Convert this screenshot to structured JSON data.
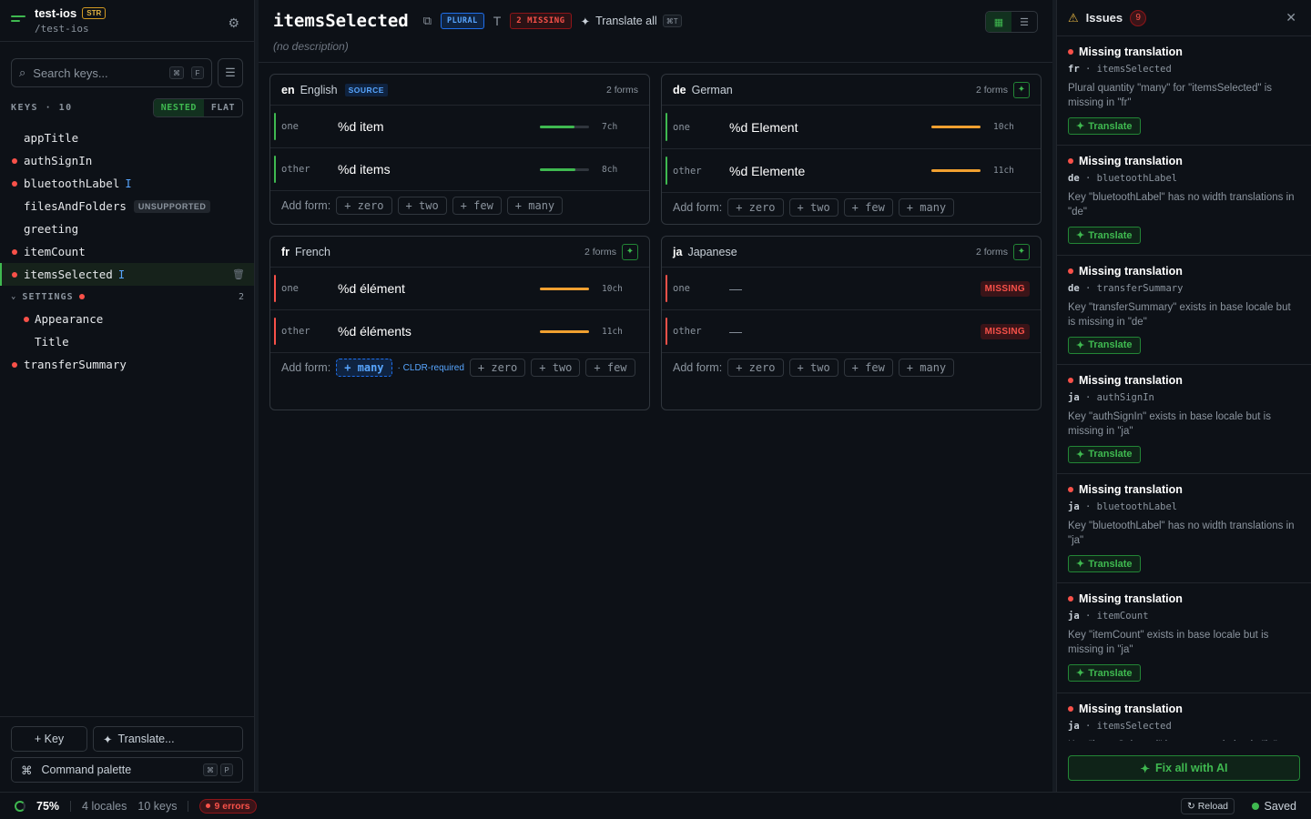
{
  "project": {
    "name": "test-ios",
    "badge": "STR",
    "path": "/test-ios"
  },
  "sidebar": {
    "search_placeholder": "Search keys...",
    "search_kbd": [
      "⌘",
      "F"
    ],
    "keys_title": "KEYS · 10",
    "view_nested": "NESTED",
    "view_flat": "FLAT",
    "keys": [
      {
        "label": "appTitle",
        "missing": false
      },
      {
        "label": "authSignIn",
        "missing": true
      },
      {
        "label": "bluetoothLabel",
        "missing": true,
        "icon": "width-icon"
      },
      {
        "label": "filesAndFolders",
        "missing": false,
        "tag": "UNSUPPORTED"
      },
      {
        "label": "greeting",
        "missing": false
      },
      {
        "label": "itemCount",
        "missing": true
      },
      {
        "label": "itemsSelected",
        "missing": true,
        "active": true
      }
    ],
    "group": {
      "label": "SETTINGS",
      "count": "2",
      "children": [
        {
          "label": "Appearance",
          "missing": true
        },
        {
          "label": "Title",
          "missing": false
        }
      ]
    },
    "last_key": {
      "label": "transferSummary",
      "missing": true
    },
    "add_key": "+ Key",
    "translate": "Translate...",
    "command_palette": "Command palette",
    "command_kbd": [
      "⌘",
      "P"
    ]
  },
  "header": {
    "title": "itemsSelected",
    "plural_badge": "PLURAL",
    "missing_badge": "2 MISSING",
    "translate_all": "Translate all",
    "translate_all_kbd": "⌘T",
    "description": "(no description)"
  },
  "locales": [
    {
      "code": "en",
      "name": "English",
      "source": "SOURCE",
      "forms_count": "2 forms",
      "forms": [
        {
          "label": "one",
          "value": "%d item",
          "ch": "7ch",
          "fill": 0.7,
          "color": "#3fb950"
        },
        {
          "label": "other",
          "value": "%d items",
          "ch": "8ch",
          "fill": 0.72,
          "color": "#3fb950"
        }
      ],
      "add_label": "Add form:",
      "add": [
        "+ zero",
        "+ two",
        "+ few",
        "+ many"
      ]
    },
    {
      "code": "de",
      "name": "German",
      "forms_count": "2 forms",
      "forms": [
        {
          "label": "one",
          "value": "%d Element",
          "ch": "10ch",
          "fill": 1.0,
          "color": "#f0a030"
        },
        {
          "label": "other",
          "value": "%d Elemente",
          "ch": "11ch",
          "fill": 1.0,
          "color": "#f0a030"
        }
      ],
      "add_label": "Add form:",
      "add": [
        "+ zero",
        "+ two",
        "+ few",
        "+ many"
      ]
    },
    {
      "code": "fr",
      "name": "French",
      "forms_count": "2 forms",
      "forms": [
        {
          "label": "one",
          "value": "%d élément",
          "ch": "10ch",
          "fill": 1.0,
          "color": "#f0a030"
        },
        {
          "label": "other",
          "value": "%d éléments",
          "ch": "11ch",
          "fill": 1.0,
          "color": "#f0a030"
        }
      ],
      "add_label": "Add form:",
      "add_required": "+ many",
      "cldr": "· CLDR-required",
      "add": [
        "+ zero",
        "+ two",
        "+ few"
      ]
    },
    {
      "code": "ja",
      "name": "Japanese",
      "forms_count": "2 forms",
      "forms": [
        {
          "label": "one",
          "value": "—",
          "missing": "MISSING"
        },
        {
          "label": "other",
          "value": "—",
          "missing": "MISSING"
        }
      ],
      "add_label": "Add form:",
      "add": [
        "+ zero",
        "+ two",
        "+ few",
        "+ many"
      ]
    }
  ],
  "issues": {
    "title": "Issues",
    "count": "9",
    "translate_label": "Translate",
    "items": [
      {
        "title": "Missing translation",
        "locale": "fr",
        "key": "itemsSelected",
        "message": "Plural quantity \"many\" for \"itemsSelected\" is missing in \"fr\""
      },
      {
        "title": "Missing translation",
        "locale": "de",
        "key": "bluetoothLabel",
        "message": "Key \"bluetoothLabel\" has no width translations in \"de\""
      },
      {
        "title": "Missing translation",
        "locale": "de",
        "key": "transferSummary",
        "message": "Key \"transferSummary\" exists in base locale but is missing in \"de\""
      },
      {
        "title": "Missing translation",
        "locale": "ja",
        "key": "authSignIn",
        "message": "Key \"authSignIn\" exists in base locale but is missing in \"ja\""
      },
      {
        "title": "Missing translation",
        "locale": "ja",
        "key": "bluetoothLabel",
        "message": "Key \"bluetoothLabel\" has no width translations in \"ja\""
      },
      {
        "title": "Missing translation",
        "locale": "ja",
        "key": "itemCount",
        "message": "Key \"itemCount\" exists in base locale but is missing in \"ja\""
      },
      {
        "title": "Missing translation",
        "locale": "ja",
        "key": "itemsSelected",
        "message": "Key \"itemsSelected\" has no translation in \"ja\""
      }
    ],
    "fix_all": "Fix all with AI"
  },
  "status": {
    "progress": "75%",
    "locales": "4 locales",
    "keys": "10 keys",
    "errors": "9 errors",
    "reload": "Reload",
    "saved": "Saved"
  }
}
